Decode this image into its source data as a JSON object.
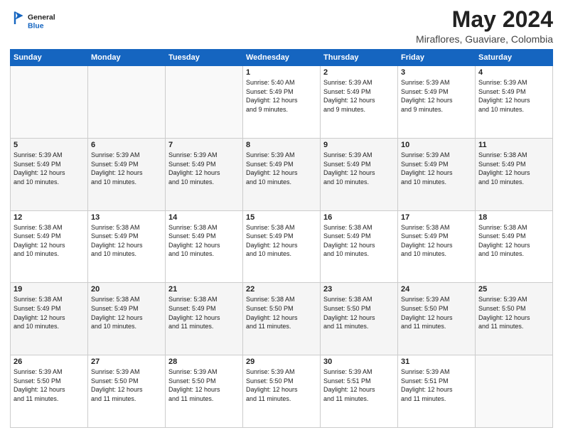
{
  "logo": {
    "general": "General",
    "blue": "Blue"
  },
  "header": {
    "title": "May 2024",
    "location": "Miraflores, Guaviare, Colombia"
  },
  "days_of_week": [
    "Sunday",
    "Monday",
    "Tuesday",
    "Wednesday",
    "Thursday",
    "Friday",
    "Saturday"
  ],
  "weeks": [
    [
      {
        "day": "",
        "info": ""
      },
      {
        "day": "",
        "info": ""
      },
      {
        "day": "",
        "info": ""
      },
      {
        "day": "1",
        "info": "Sunrise: 5:40 AM\nSunset: 5:49 PM\nDaylight: 12 hours\nand 9 minutes."
      },
      {
        "day": "2",
        "info": "Sunrise: 5:39 AM\nSunset: 5:49 PM\nDaylight: 12 hours\nand 9 minutes."
      },
      {
        "day": "3",
        "info": "Sunrise: 5:39 AM\nSunset: 5:49 PM\nDaylight: 12 hours\nand 9 minutes."
      },
      {
        "day": "4",
        "info": "Sunrise: 5:39 AM\nSunset: 5:49 PM\nDaylight: 12 hours\nand 10 minutes."
      }
    ],
    [
      {
        "day": "5",
        "info": "Sunrise: 5:39 AM\nSunset: 5:49 PM\nDaylight: 12 hours\nand 10 minutes."
      },
      {
        "day": "6",
        "info": "Sunrise: 5:39 AM\nSunset: 5:49 PM\nDaylight: 12 hours\nand 10 minutes."
      },
      {
        "day": "7",
        "info": "Sunrise: 5:39 AM\nSunset: 5:49 PM\nDaylight: 12 hours\nand 10 minutes."
      },
      {
        "day": "8",
        "info": "Sunrise: 5:39 AM\nSunset: 5:49 PM\nDaylight: 12 hours\nand 10 minutes."
      },
      {
        "day": "9",
        "info": "Sunrise: 5:39 AM\nSunset: 5:49 PM\nDaylight: 12 hours\nand 10 minutes."
      },
      {
        "day": "10",
        "info": "Sunrise: 5:39 AM\nSunset: 5:49 PM\nDaylight: 12 hours\nand 10 minutes."
      },
      {
        "day": "11",
        "info": "Sunrise: 5:38 AM\nSunset: 5:49 PM\nDaylight: 12 hours\nand 10 minutes."
      }
    ],
    [
      {
        "day": "12",
        "info": "Sunrise: 5:38 AM\nSunset: 5:49 PM\nDaylight: 12 hours\nand 10 minutes."
      },
      {
        "day": "13",
        "info": "Sunrise: 5:38 AM\nSunset: 5:49 PM\nDaylight: 12 hours\nand 10 minutes."
      },
      {
        "day": "14",
        "info": "Sunrise: 5:38 AM\nSunset: 5:49 PM\nDaylight: 12 hours\nand 10 minutes."
      },
      {
        "day": "15",
        "info": "Sunrise: 5:38 AM\nSunset: 5:49 PM\nDaylight: 12 hours\nand 10 minutes."
      },
      {
        "day": "16",
        "info": "Sunrise: 5:38 AM\nSunset: 5:49 PM\nDaylight: 12 hours\nand 10 minutes."
      },
      {
        "day": "17",
        "info": "Sunrise: 5:38 AM\nSunset: 5:49 PM\nDaylight: 12 hours\nand 10 minutes."
      },
      {
        "day": "18",
        "info": "Sunrise: 5:38 AM\nSunset: 5:49 PM\nDaylight: 12 hours\nand 10 minutes."
      }
    ],
    [
      {
        "day": "19",
        "info": "Sunrise: 5:38 AM\nSunset: 5:49 PM\nDaylight: 12 hours\nand 10 minutes."
      },
      {
        "day": "20",
        "info": "Sunrise: 5:38 AM\nSunset: 5:49 PM\nDaylight: 12 hours\nand 10 minutes."
      },
      {
        "day": "21",
        "info": "Sunrise: 5:38 AM\nSunset: 5:49 PM\nDaylight: 12 hours\nand 11 minutes."
      },
      {
        "day": "22",
        "info": "Sunrise: 5:38 AM\nSunset: 5:50 PM\nDaylight: 12 hours\nand 11 minutes."
      },
      {
        "day": "23",
        "info": "Sunrise: 5:38 AM\nSunset: 5:50 PM\nDaylight: 12 hours\nand 11 minutes."
      },
      {
        "day": "24",
        "info": "Sunrise: 5:39 AM\nSunset: 5:50 PM\nDaylight: 12 hours\nand 11 minutes."
      },
      {
        "day": "25",
        "info": "Sunrise: 5:39 AM\nSunset: 5:50 PM\nDaylight: 12 hours\nand 11 minutes."
      }
    ],
    [
      {
        "day": "26",
        "info": "Sunrise: 5:39 AM\nSunset: 5:50 PM\nDaylight: 12 hours\nand 11 minutes."
      },
      {
        "day": "27",
        "info": "Sunrise: 5:39 AM\nSunset: 5:50 PM\nDaylight: 12 hours\nand 11 minutes."
      },
      {
        "day": "28",
        "info": "Sunrise: 5:39 AM\nSunset: 5:50 PM\nDaylight: 12 hours\nand 11 minutes."
      },
      {
        "day": "29",
        "info": "Sunrise: 5:39 AM\nSunset: 5:50 PM\nDaylight: 12 hours\nand 11 minutes."
      },
      {
        "day": "30",
        "info": "Sunrise: 5:39 AM\nSunset: 5:51 PM\nDaylight: 12 hours\nand 11 minutes."
      },
      {
        "day": "31",
        "info": "Sunrise: 5:39 AM\nSunset: 5:51 PM\nDaylight: 12 hours\nand 11 minutes."
      },
      {
        "day": "",
        "info": ""
      }
    ]
  ]
}
